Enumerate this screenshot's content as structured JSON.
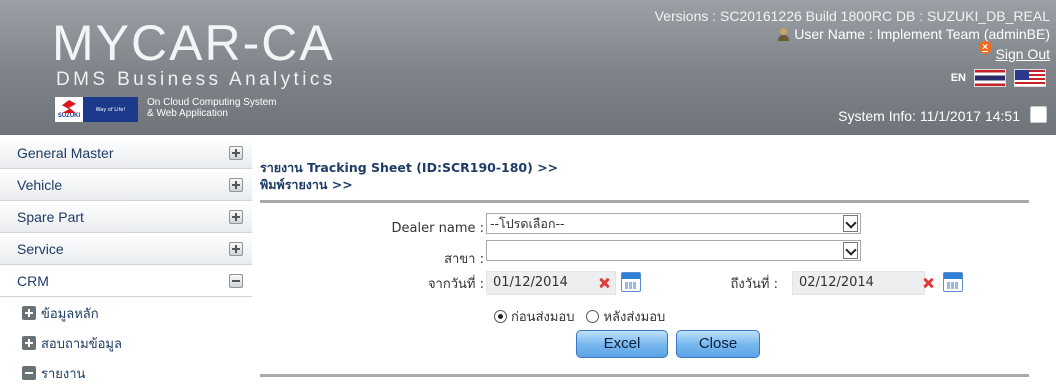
{
  "header": {
    "brand_title": "MYCAR-CA",
    "brand_subtitle": "DMS Business Analytics",
    "cloud_line1": "On Cloud Computing System",
    "cloud_line2": "& Web Application",
    "logo_brand": "SUZUKI",
    "logo_tagline": "Way of Life!",
    "versions": "Versions : SC20161226 Build 1800RC DB : SUZUKI_DB_REAL",
    "user_name": "User Name : Implement Team (adminBE)",
    "sign_out": "Sign Out",
    "language": "EN",
    "system_info": "System Info: 11/1/2017 14:51"
  },
  "sidebar": {
    "items": [
      {
        "label": "General Master",
        "icon": "plus-icon"
      },
      {
        "label": "Vehicle",
        "icon": "plus-icon"
      },
      {
        "label": "Spare Part",
        "icon": "plus-icon"
      },
      {
        "label": "Service",
        "icon": "plus-icon"
      },
      {
        "label": "CRM",
        "icon": "minus-icon"
      }
    ],
    "sub_items": [
      {
        "label": "ข้อมูลหลัก",
        "icon": "plus-icon"
      },
      {
        "label": "สอบถามข้อมูล",
        "icon": "plus-icon"
      },
      {
        "label": "รายงาน",
        "icon": "minus-icon"
      }
    ]
  },
  "main": {
    "breadcrumb_line1": "รายงาน Tracking Sheet (ID:SCR190-180) >>",
    "breadcrumb_line2": "พิมพ์รายงาน >>",
    "form": {
      "dealer_label": "Dealer name :",
      "dealer_value": "--โปรดเลือก--",
      "branch_label": "สาขา :",
      "branch_value": "",
      "from_date_label": "จากวันที่ :",
      "from_date_value": "01/12/2014",
      "to_date_label": "ถึงวันที่ :",
      "to_date_value": "02/12/2014",
      "radio_before": "ก่อนส่งมอบ",
      "radio_after": "หลังส่งมอบ",
      "radio_selected": "before",
      "excel_button": "Excel",
      "close_button": "Close"
    }
  },
  "colors": {
    "header_bg": "#7d8389",
    "menu_text": "#1e3c66",
    "button_blue": "#7ab9ef",
    "clear_red": "#e03b3b"
  }
}
